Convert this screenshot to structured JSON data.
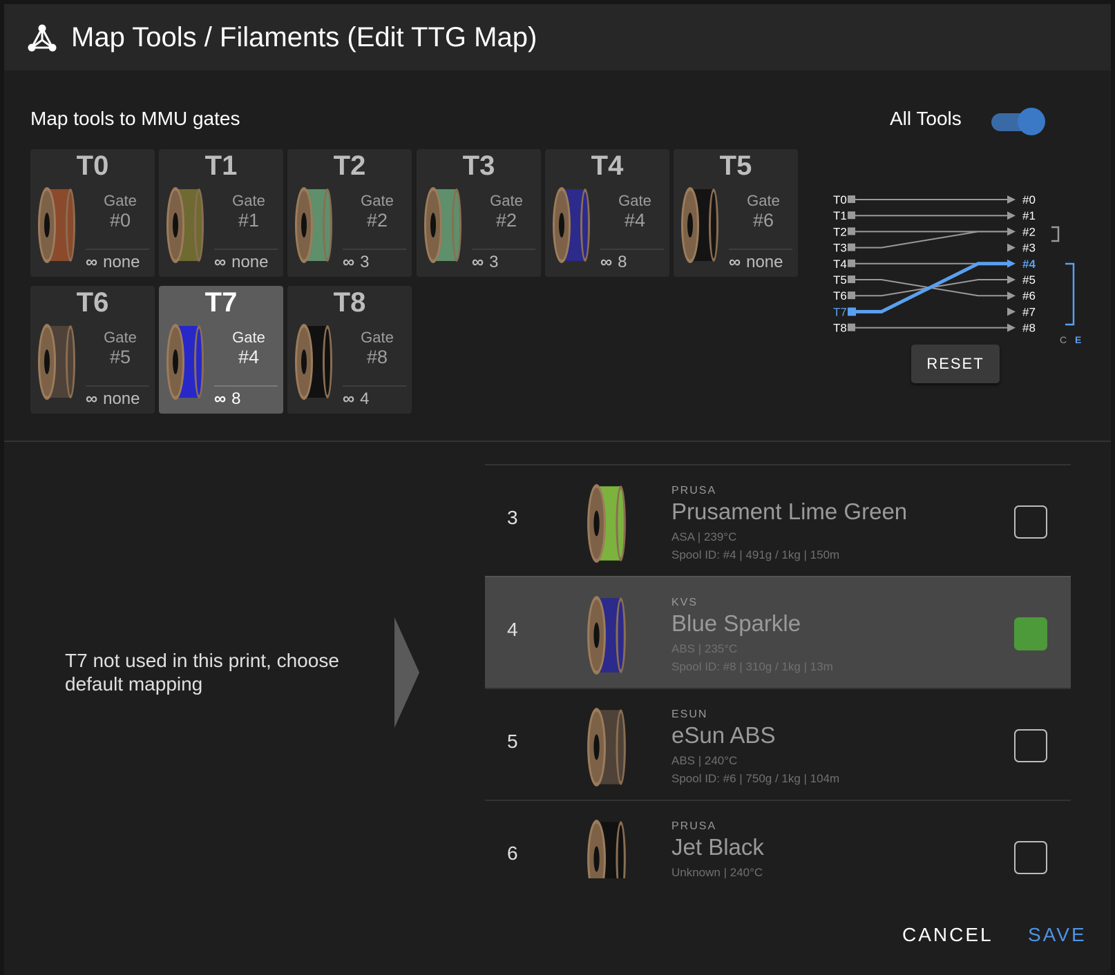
{
  "dialog": {
    "title": "Map Tools / Filaments (Edit TTG Map)",
    "icon": "mmu-network-icon",
    "section_label": "Map tools to MMU gates",
    "all_tools_label": "All Tools",
    "all_tools_enabled": true
  },
  "tools": [
    {
      "name": "T0",
      "gate_label": "Gate",
      "gate": "#0",
      "inf_sym": "∞",
      "inf": "none",
      "color": "#8b4a2c",
      "selected": false
    },
    {
      "name": "T1",
      "gate_label": "Gate",
      "gate": "#1",
      "inf_sym": "∞",
      "inf": "none",
      "color": "#6e6a32",
      "selected": false
    },
    {
      "name": "T2",
      "gate_label": "Gate",
      "gate": "#2",
      "inf_sym": "∞",
      "inf": "3",
      "color": "#5f8f6b",
      "selected": false
    },
    {
      "name": "T3",
      "gate_label": "Gate",
      "gate": "#2",
      "inf_sym": "∞",
      "inf": "3",
      "color": "#5f8f6b",
      "selected": false
    },
    {
      "name": "T4",
      "gate_label": "Gate",
      "gate": "#4",
      "inf_sym": "∞",
      "inf": "8",
      "color": "#2c2a8a",
      "selected": false
    },
    {
      "name": "T5",
      "gate_label": "Gate",
      "gate": "#6",
      "inf_sym": "∞",
      "inf": "none",
      "color": "#141414",
      "selected": false
    },
    {
      "name": "T6",
      "gate_label": "Gate",
      "gate": "#5",
      "inf_sym": "∞",
      "inf": "none",
      "color": "#4f4238",
      "selected": false
    },
    {
      "name": "T7",
      "gate_label": "Gate",
      "gate": "#4",
      "inf_sym": "∞",
      "inf": "8",
      "color": "#2828c8",
      "selected": true
    },
    {
      "name": "T8",
      "gate_label": "Gate",
      "gate": "#8",
      "inf_sym": "∞",
      "inf": "4",
      "color": "#111111",
      "selected": false
    }
  ],
  "ttg_map": {
    "tool_labels": [
      "T0",
      "T1",
      "T2",
      "T3",
      "T4",
      "T5",
      "T6",
      "T7",
      "T8"
    ],
    "gate_labels": [
      "#0",
      "#1",
      "#2",
      "#3",
      "#4",
      "#5",
      "#6",
      "#7",
      "#8"
    ],
    "mapping": [
      0,
      1,
      2,
      2,
      4,
      6,
      5,
      4,
      8
    ],
    "highlight_tool": 7,
    "c_label": "C",
    "e_label": "E",
    "reset_label": "RESET",
    "line_color": "#9a9a9a",
    "highlight_color": "#5aa0f0"
  },
  "hint": "T7 not used in this print, choose default mapping",
  "gates": [
    {
      "num": "3",
      "vendor": "PRUSA",
      "name": "Prusament Lime Green",
      "meta": "ASA | 239°C",
      "spool": "Spool ID: #4 | 491g / 1kg | 150m",
      "color": "#7cb33e",
      "checked": false
    },
    {
      "num": "4",
      "vendor": "KVS",
      "name": "Blue Sparkle",
      "meta": "ABS | 235°C",
      "spool": "Spool ID: #8 | 310g / 1kg | 13m",
      "color": "#2c2a8a",
      "checked": true
    },
    {
      "num": "5",
      "vendor": "ESUN",
      "name": "eSun ABS",
      "meta": "ABS | 240°C",
      "spool": "Spool ID: #6 | 750g / 1kg | 104m",
      "color": "#4f4238",
      "checked": false
    },
    {
      "num": "6",
      "vendor": "PRUSA",
      "name": "Jet Black",
      "meta": "Unknown | 240°C",
      "spool": "",
      "color": "#111111",
      "checked": false
    }
  ],
  "footer": {
    "cancel_label": "CANCEL",
    "save_label": "SAVE"
  }
}
